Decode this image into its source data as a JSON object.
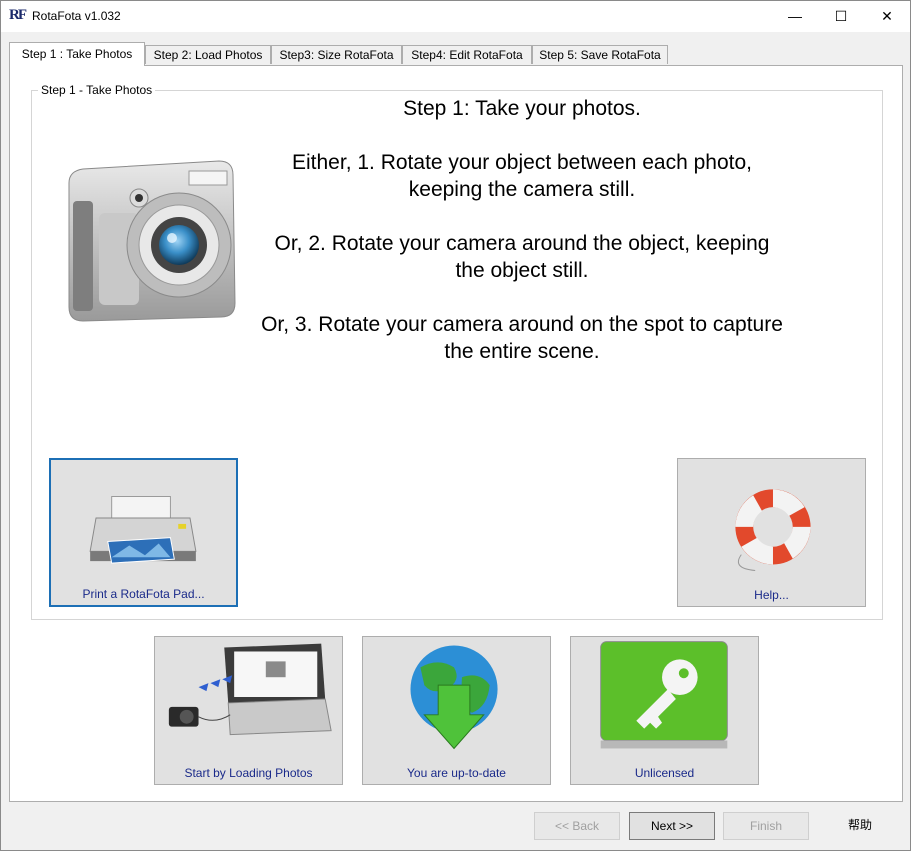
{
  "window": {
    "title": "RotaFota v1.032",
    "icon_text": "RF",
    "controls": {
      "minimize": "—",
      "maximize": "☐",
      "close": "✕"
    }
  },
  "tabs": [
    {
      "label": "Step 1 : Take Photos",
      "active": true
    },
    {
      "label": "Step 2: Load Photos",
      "active": false
    },
    {
      "label": "Step3: Size RotaFota",
      "active": false
    },
    {
      "label": "Step4: Edit RotaFota",
      "active": false
    },
    {
      "label": "Step 5: Save RotaFota",
      "active": false
    }
  ],
  "group": {
    "legend": "Step 1 - Take Photos"
  },
  "instructions": {
    "heading": "Step 1: Take your photos.",
    "option1_a": "Either, 1. Rotate your object between each photo,",
    "option1_b": "keeping the camera still.",
    "option2_a": "Or, 2. Rotate your camera around the object, keeping",
    "option2_b": "the object still.",
    "option3_a": "Or, 3. Rotate your camera around on the spot to capture",
    "option3_b": "the entire scene."
  },
  "tiles": {
    "print": "Print a RotaFota Pad...",
    "help": "Help...",
    "start": "Start by Loading Photos",
    "update": "You are up-to-date",
    "license": "Unlicensed"
  },
  "footer": {
    "back": "<< Back",
    "next": "Next >>",
    "finish": "Finish",
    "help": "帮助"
  }
}
